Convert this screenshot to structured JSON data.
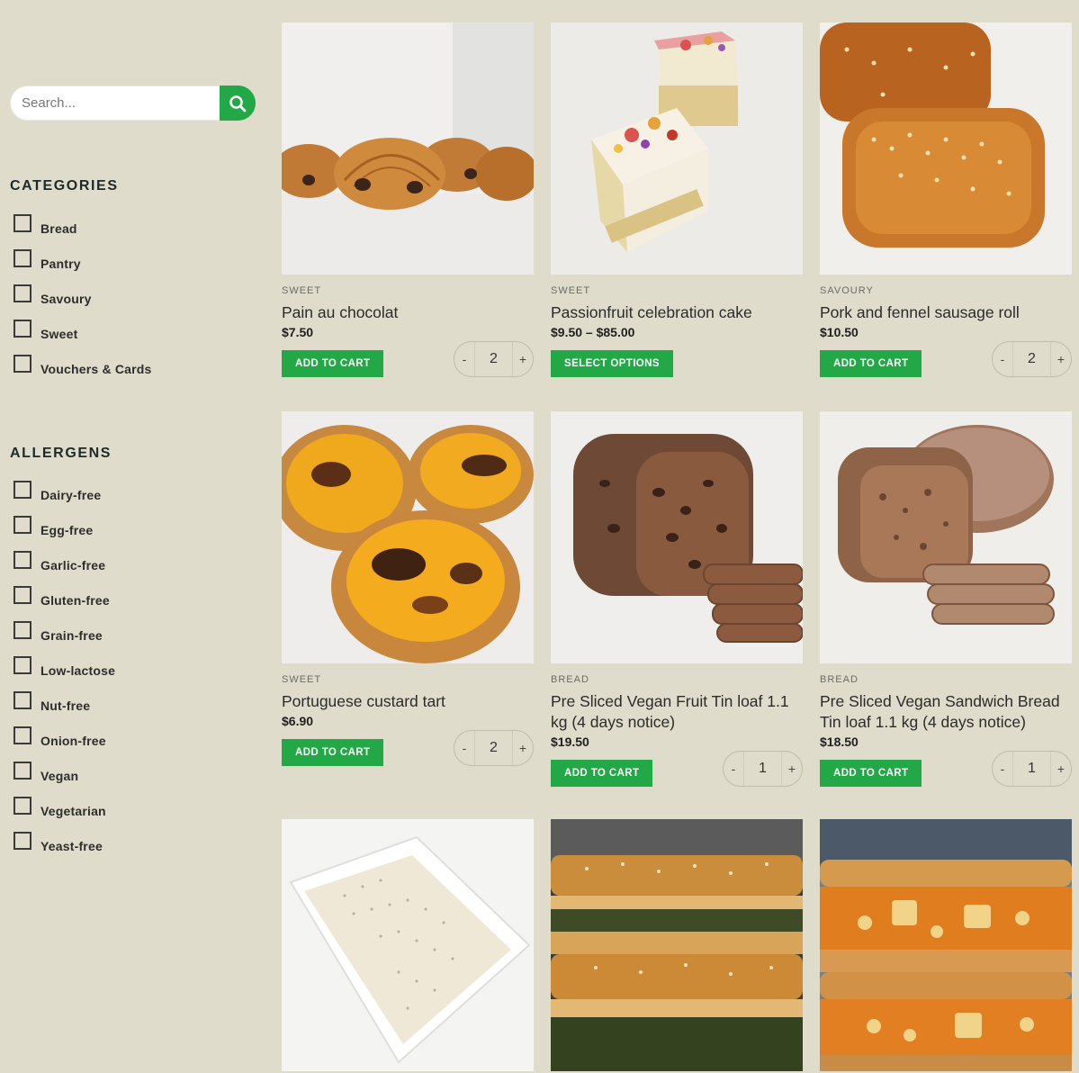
{
  "search": {
    "placeholder": "Search..."
  },
  "categories": {
    "title": "CATEGORIES",
    "items": [
      "Bread",
      "Pantry",
      "Savoury",
      "Sweet",
      "Vouchers & Cards"
    ]
  },
  "allergens": {
    "title": "ALLERGENS",
    "items": [
      "Dairy-free",
      "Egg-free",
      "Garlic-free",
      "Gluten-free",
      "Grain-free",
      "Low-lactose",
      "Nut-free",
      "Onion-free",
      "Vegan",
      "Vegetarian",
      "Yeast-free"
    ]
  },
  "products": [
    {
      "category": "SWEET",
      "name": "Pain au chocolat",
      "price": "$7.50",
      "button": "ADD TO CART",
      "qty": "2",
      "image": "pain-au-chocolat"
    },
    {
      "category": "SWEET",
      "name": "Passionfruit celebration cake",
      "price": "$9.50 – $85.00",
      "button": "SELECT OPTIONS",
      "qty": null,
      "image": "passionfruit-cake"
    },
    {
      "category": "SAVOURY",
      "name": "Pork and fennel sausage roll",
      "price": "$10.50",
      "button": "ADD TO CART",
      "qty": "2",
      "image": "sausage-roll"
    },
    {
      "category": "SWEET",
      "name": "Portuguese custard tart",
      "price": "$6.90",
      "button": "ADD TO CART",
      "qty": "2",
      "image": "custard-tart"
    },
    {
      "category": "BREAD",
      "name": "Pre Sliced Vegan Fruit Tin loaf 1.1 kg (4 days notice)",
      "price": "$19.50",
      "button": "ADD TO CART",
      "qty": "1",
      "image": "fruit-loaf"
    },
    {
      "category": "BREAD",
      "name": "Pre Sliced Vegan Sandwich Bread Tin loaf 1.1 kg (4 days notice)",
      "price": "$18.50",
      "button": "ADD TO CART",
      "qty": "1",
      "image": "sandwich-loaf"
    },
    {
      "image": "voucher-card"
    },
    {
      "image": "spinach-pastry"
    },
    {
      "image": "vegetable-pie"
    }
  ],
  "qty_controls": {
    "minus": "-",
    "plus": "+"
  },
  "colors": {
    "background": "#dfdccb",
    "accent_green": "#22a846"
  }
}
